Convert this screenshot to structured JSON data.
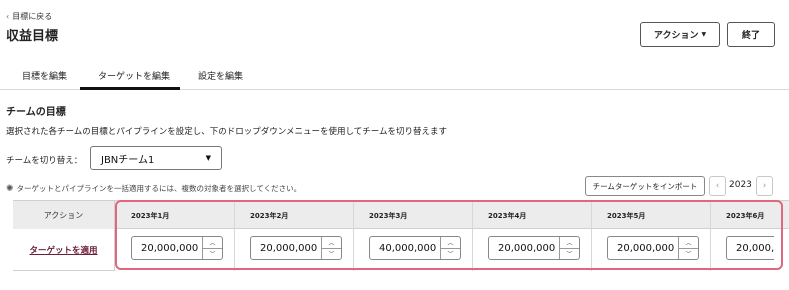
{
  "header": {
    "back_label": "目標に戻る",
    "title": "収益目標",
    "action_button": "アクション",
    "end_button": "終了"
  },
  "tabs": [
    {
      "label": "目標を編集",
      "active": false
    },
    {
      "label": "ターゲットを編集",
      "active": true
    },
    {
      "label": "設定を編集",
      "active": false
    }
  ],
  "section": {
    "title": "チームの目標",
    "description": "選択された各チームの目標とパイプラインを設定し、下のドロップダウンメニューを使用してチームを切り替えます",
    "switch_label": "チームを切り替え：",
    "selected_team": "JBNチーム1",
    "hint": "ターゲットとパイプラインを一括適用するには、複数の対象者を選択してください。"
  },
  "toolbar": {
    "import_button": "チームターゲットをインポート",
    "year": "2023"
  },
  "table": {
    "action_header": "アクション",
    "apply_link": "ターゲットを適用",
    "months": [
      "2023年1月",
      "2023年2月",
      "2023年3月",
      "2023年4月",
      "2023年5月",
      "2023年6月"
    ],
    "values": [
      "20,000,000",
      "20,000,000",
      "40,000,000",
      "20,000,000",
      "20,000,000",
      "20,000,0"
    ]
  },
  "colors": {
    "highlight_border": "#e0687e",
    "link": "#6b1e3a"
  }
}
